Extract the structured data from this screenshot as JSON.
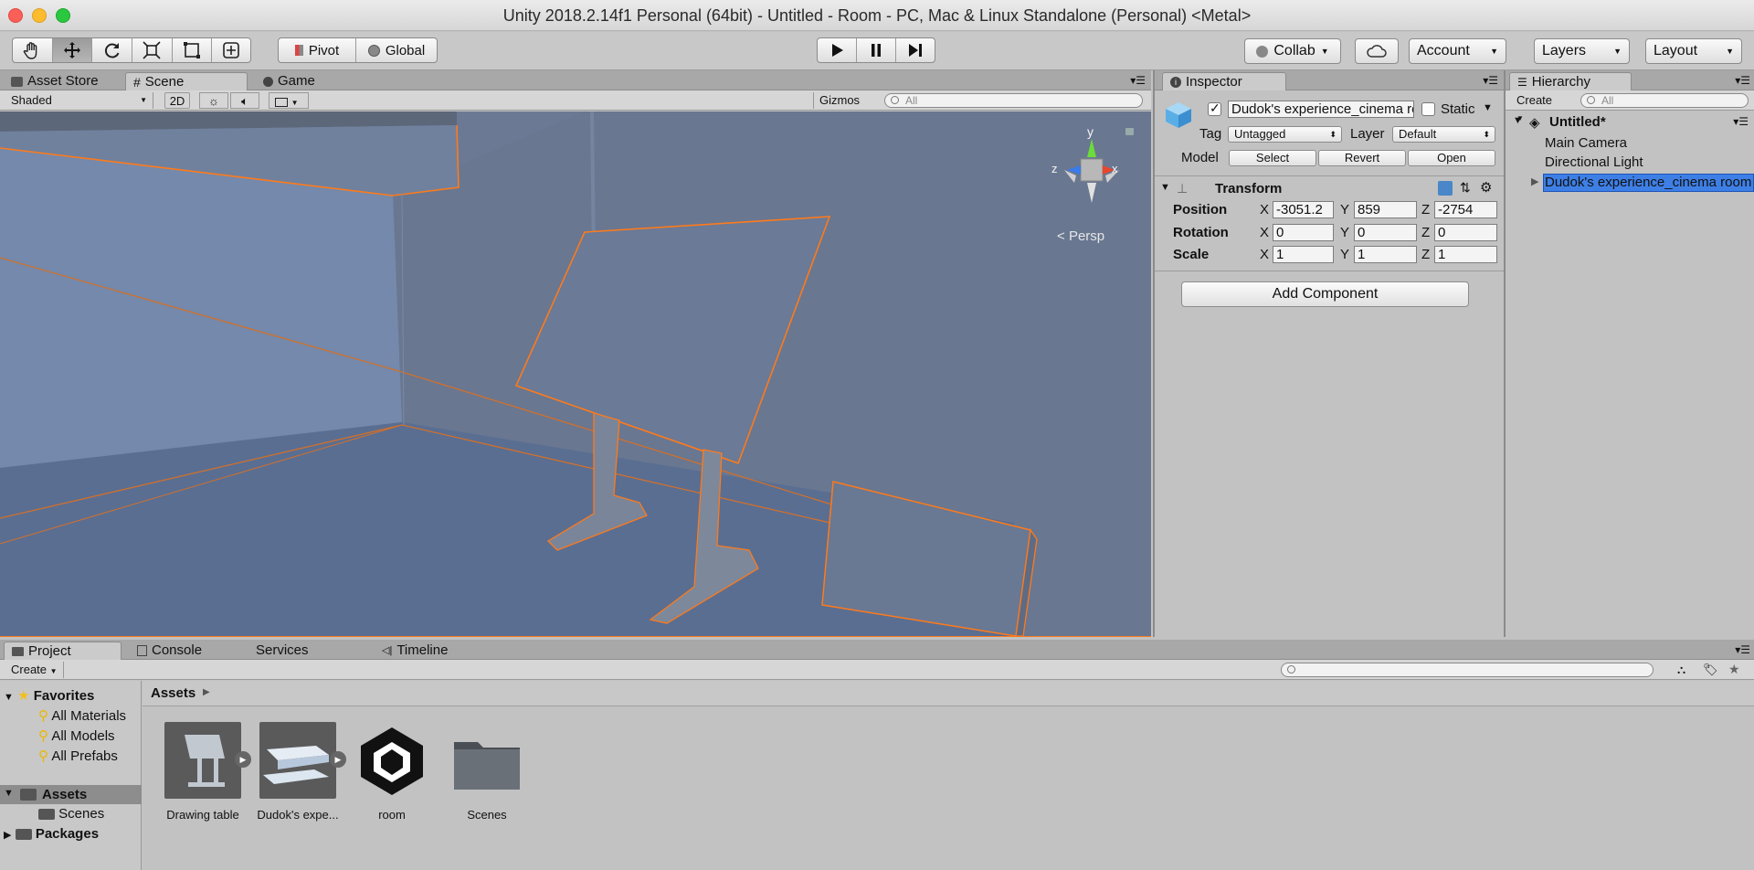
{
  "window": {
    "title": "Unity 2018.2.14f1 Personal (64bit) - Untitled - Room - PC, Mac & Linux Standalone (Personal) <Metal>"
  },
  "toolbar": {
    "pivot": "Pivot",
    "global": "Global",
    "collab": "Collab",
    "account": "Account",
    "layers": "Layers",
    "layout": "Layout"
  },
  "scene_panel": {
    "tabs": [
      "Asset Store",
      "Scene",
      "Game"
    ],
    "shading_mode": "Shaded",
    "mode_2d": "2D",
    "gizmos": "Gizmos",
    "search_placeholder": "All",
    "persp_label": "Persp",
    "axes": {
      "y": "y",
      "x": "x",
      "z": "z"
    }
  },
  "inspector": {
    "tab": "Inspector",
    "object_name": "Dudok's experience_cinema room",
    "static_label": "Static",
    "tag_label": "Tag",
    "tag_value": "Untagged",
    "layer_label": "Layer",
    "layer_value": "Default",
    "model_label": "Model",
    "model_buttons": [
      "Select",
      "Revert",
      "Open"
    ],
    "transform": {
      "title": "Transform",
      "rows": [
        {
          "label": "Position",
          "x": "-3051.2",
          "y": "859",
          "z": "-2754"
        },
        {
          "label": "Rotation",
          "x": "0",
          "y": "0",
          "z": "0"
        },
        {
          "label": "Scale",
          "x": "1",
          "y": "1",
          "z": "1"
        }
      ],
      "axis_labels": [
        "X",
        "Y",
        "Z"
      ]
    },
    "add_component": "Add Component"
  },
  "hierarchy": {
    "tab": "Hierarchy",
    "create": "Create",
    "search_placeholder": "All",
    "scene": "Untitled*",
    "items": [
      "Main Camera",
      "Directional Light",
      "Dudok's experience_cinema room"
    ]
  },
  "bottom": {
    "tabs": [
      "Project",
      "Console",
      "Services",
      "Timeline"
    ],
    "create": "Create",
    "favorites_label": "Favorites",
    "favorites": [
      "All Materials",
      "All Models",
      "All Prefabs"
    ],
    "assets_label": "Assets",
    "asset_folders": [
      "Scenes"
    ],
    "packages_label": "Packages",
    "breadcrumb": "Assets",
    "assets": [
      {
        "name": "Drawing table",
        "icon": "model-icon"
      },
      {
        "name": "Dudok's expe...",
        "icon": "model-icon"
      },
      {
        "name": "room",
        "icon": "unity-scene-icon"
      },
      {
        "name": "Scenes",
        "icon": "folder-icon"
      }
    ]
  },
  "colors": {
    "selection_outline": "#ff7a1a",
    "selection_blue": "#3e7fe6",
    "scene_bg": "#6a7a94"
  }
}
